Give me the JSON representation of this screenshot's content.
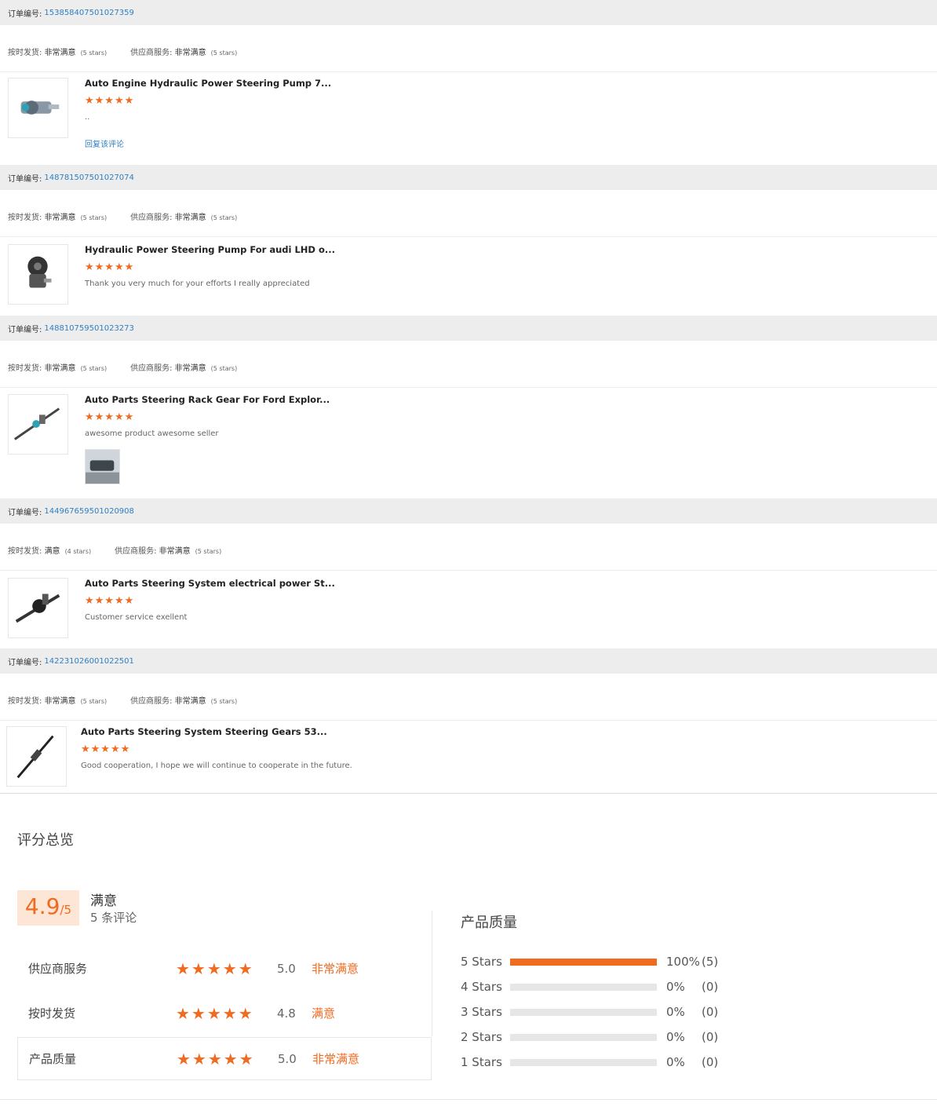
{
  "labels": {
    "order_no": "订单编号:",
    "shipping": "按时发货:",
    "supplier": "供应商服务:",
    "stars_suffix": "stars",
    "reply": "回复该评论"
  },
  "orders": [
    {
      "number": "153858407501027359",
      "shipping_rating": "非常满意",
      "shipping_stars": "(5 stars)",
      "supplier_rating": "非常满意",
      "supplier_stars": "(5 stars)",
      "product_title": "Auto Engine Hydraulic Power Steering Pump 7...",
      "stars": "★★★★★",
      "comment": "..",
      "reply": "回复该评论"
    },
    {
      "number": "148781507501027074",
      "shipping_rating": "非常满意",
      "shipping_stars": "(5 stars)",
      "supplier_rating": "非常满意",
      "supplier_stars": "(5 stars)",
      "product_title": "Hydraulic Power Steering Pump For audi LHD o...",
      "stars": "★★★★★",
      "comment": "Thank you very much for your efforts I really appreciated"
    },
    {
      "number": "148810759501023273",
      "shipping_rating": "非常满意",
      "shipping_stars": "(5 stars)",
      "supplier_rating": "非常满意",
      "supplier_stars": "(5 stars)",
      "product_title": "Auto Parts Steering Rack Gear For Ford Explor...",
      "stars": "★★★★★",
      "comment": "awesome product awesome seller"
    },
    {
      "number": "144967659501020908",
      "shipping_rating": "满意",
      "shipping_stars": "(4 stars)",
      "supplier_rating": "非常满意",
      "supplier_stars": "(5 stars)",
      "product_title": "Auto Parts Steering System electrical power St...",
      "stars": "★★★★★",
      "comment": "Customer service exellent"
    },
    {
      "number": "142231026001022501",
      "shipping_rating": "非常满意",
      "shipping_stars": "(5 stars)",
      "supplier_rating": "非常满意",
      "supplier_stars": "(5 stars)",
      "product_title": "Auto Parts Steering System Steering Gears 53...",
      "stars": "★★★★★",
      "comment": "Good cooperation, I hope we will continue to cooperate in the future."
    }
  ],
  "summary": {
    "title": "评分总览",
    "score": "4.9",
    "score_den": "/5",
    "satisfaction": "满意",
    "review_count": "5 条评论",
    "rows": [
      {
        "label": "供应商服务",
        "stars": "★★★★★",
        "value": "5.0",
        "text": "非常满意"
      },
      {
        "label": "按时发货",
        "stars": "★★★★★",
        "value": "4.8",
        "text": "满意"
      },
      {
        "label": "产品质量",
        "stars": "★★★★★",
        "value": "5.0",
        "text": "非常满意"
      }
    ]
  },
  "product_quality": {
    "title": "产品质量",
    "bars": [
      {
        "label": "5  Stars",
        "fraction": 1.0,
        "percent": "100%",
        "count": "(5)"
      },
      {
        "label": "4  Stars",
        "fraction": 0.0,
        "percent": "0%",
        "count": "(0)"
      },
      {
        "label": "3  Stars",
        "fraction": 0.0,
        "percent": "0%",
        "count": "(0)"
      },
      {
        "label": "2  Stars",
        "fraction": 0.0,
        "percent": "0%",
        "count": "(0)"
      },
      {
        "label": "1  Stars",
        "fraction": 0.0,
        "percent": "0%",
        "count": "(0)"
      }
    ]
  },
  "colors": {
    "accent": "#f06a1f",
    "link": "#2f7fc1",
    "header_bg": "#ededed"
  }
}
